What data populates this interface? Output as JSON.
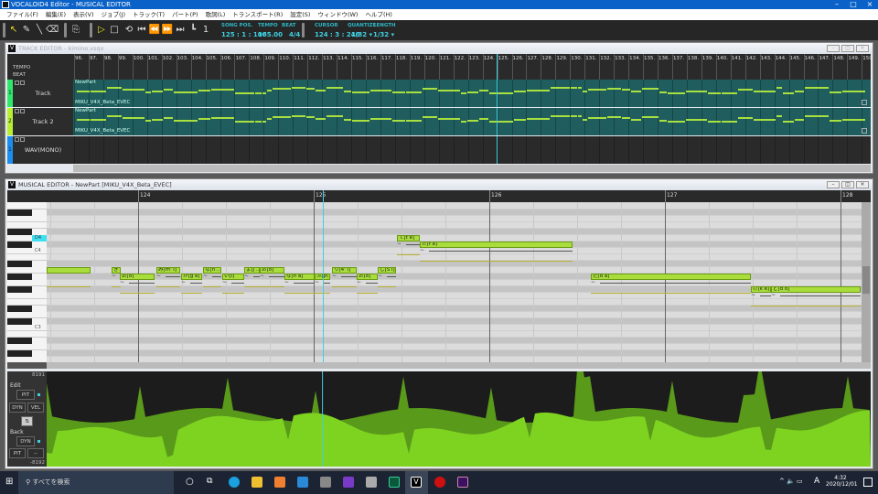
{
  "window": {
    "title": "VOCALOID4 Editor - MUSICAL EDITOR"
  },
  "menu": [
    "ファイル(F)",
    "編集(E)",
    "表示(V)",
    "ジョブ(J)",
    "トラック(T)",
    "パート(P)",
    "歌詞(L)",
    "トランスポート(R)",
    "設定(S)",
    "ウィンドウ(W)",
    "ヘルプ(H)"
  ],
  "toolbar": {
    "song_pos_label": "SONG POS.",
    "song_pos": "125 : 1 : 100",
    "tempo_label": "TEMPO",
    "tempo": "165.00",
    "beat_label": "BEAT",
    "beat": "4/4",
    "cursor_label": "CURSOR",
    "cursor": "124 : 3 : 240",
    "quantize_label": "QUANTIZE",
    "quantize": "1/32 ▾",
    "length_label": "LENGTH",
    "length": "1/32 ▾"
  },
  "track_editor": {
    "title": "TRACK EDITOR - kimino.vsqx",
    "tempo_label": "TEMPO",
    "beat_label": "BEAT",
    "measure_start": 96,
    "measure_end": 150,
    "tracks": [
      {
        "num": "1",
        "name": "Track",
        "part": "NewPart",
        "singer": "MIKU_V4X_Beta_EVEC",
        "color": "#2ee86a"
      },
      {
        "num": "2",
        "name": "Track 2",
        "part": "NewPart",
        "singer": "MIKU_V4X_Beta_EVEC",
        "color": "#b8f030"
      },
      {
        "num": "1",
        "name": "WAV(MONO)",
        "color": "#1a8ef0"
      }
    ]
  },
  "musical_editor": {
    "title": "MUSICAL EDITOR - NewPart [MIKU_V4X_Beta_EVEC]",
    "measures": [
      "124",
      "125",
      "126",
      "127",
      "128"
    ],
    "key_labels": {
      "highlight": "D4",
      "c4": "C4",
      "c3": "C3"
    },
    "playhead_measure": 125.05,
    "notes": [
      {
        "lyric": "",
        "phoneme": "",
        "start": 123.479,
        "beats": 1.0,
        "pitch": 57
      },
      {
        "lyric": "き",
        "phoneme": "",
        "start": 123.849,
        "beats": 0.2,
        "pitch": 57
      },
      {
        "lyric": "お",
        "phoneme": "[o]",
        "start": 123.896,
        "beats": 0.8,
        "pitch": 56
      },
      {
        "lyric": "み",
        "phoneme": "[m' i]",
        "start": 124.104,
        "beats": 0.55,
        "pitch": 57
      },
      {
        "lyric": "が",
        "phoneme": "[g a]",
        "start": 124.245,
        "beats": 0.48,
        "pitch": 56
      },
      {
        "lyric": "な",
        "phoneme": "[n ...",
        "start": 124.37,
        "beats": 0.42,
        "pitch": 57
      },
      {
        "lyric": "い",
        "phoneme": "[i]",
        "start": 124.479,
        "beats": 0.5,
        "pitch": 56
      },
      {
        "lyric": "よ",
        "phoneme": "[j ...",
        "start": 124.604,
        "beats": 0.35,
        "pitch": 57
      },
      {
        "lyric": "お",
        "phoneme": "[o]",
        "start": 124.693,
        "beats": 0.56,
        "pitch": 57
      },
      {
        "lyric": "な",
        "phoneme": "[n a]",
        "start": 124.833,
        "beats": 0.69,
        "pitch": 56
      },
      {
        "lyric": "ふ",
        "phoneme": "[p\\ M]",
        "start": 125.005,
        "beats": 0.35,
        "pitch": 56
      },
      {
        "lyric": "り",
        "phoneme": "[4' i]",
        "start": 125.104,
        "beats": 0.56,
        "pitch": 57
      },
      {
        "lyric": "お",
        "phoneme": "[o]",
        "start": 125.245,
        "beats": 0.48,
        "pitch": 56
      },
      {
        "lyric": "し",
        "phoneme": "[S i]",
        "start": 125.365,
        "beats": 0.42,
        "pitch": 57
      },
      {
        "lyric": "て",
        "phoneme": "[t e]",
        "start": 125.474,
        "beats": 0.52,
        "pitch": 62
      },
      {
        "lyric": "た",
        "phoneme": "[t a]",
        "start": 125.604,
        "beats": 3.48,
        "pitch": 61
      },
      {
        "lyric": "だ",
        "phoneme": "[d a]",
        "start": 126.578,
        "beats": 3.65,
        "pitch": 56
      },
      {
        "lyric": "け",
        "phoneme": "[k e]",
        "start": 127.49,
        "beats": 0.46,
        "pitch": 54
      },
      {
        "lyric": "ど",
        "phoneme": "[d o]",
        "start": 127.604,
        "beats": 2.04,
        "pitch": 54
      }
    ]
  },
  "control_track": {
    "max": "8191",
    "min": "-8192",
    "edit_label": "Edit",
    "edit_param": "PIT",
    "btn_dyn": "DYN",
    "btn_vel": "VEL",
    "swap": "⇅",
    "back_label": "Back",
    "back_param": "DYN",
    "btn_pit": "PIT",
    "btn_none": "--",
    "colors": {
      "front": "#7ed321",
      "back": "#5a9a1a"
    }
  },
  "taskbar": {
    "search": "すべてを検索",
    "time": "4:32",
    "date": "2020/12/01",
    "ime": "A"
  }
}
